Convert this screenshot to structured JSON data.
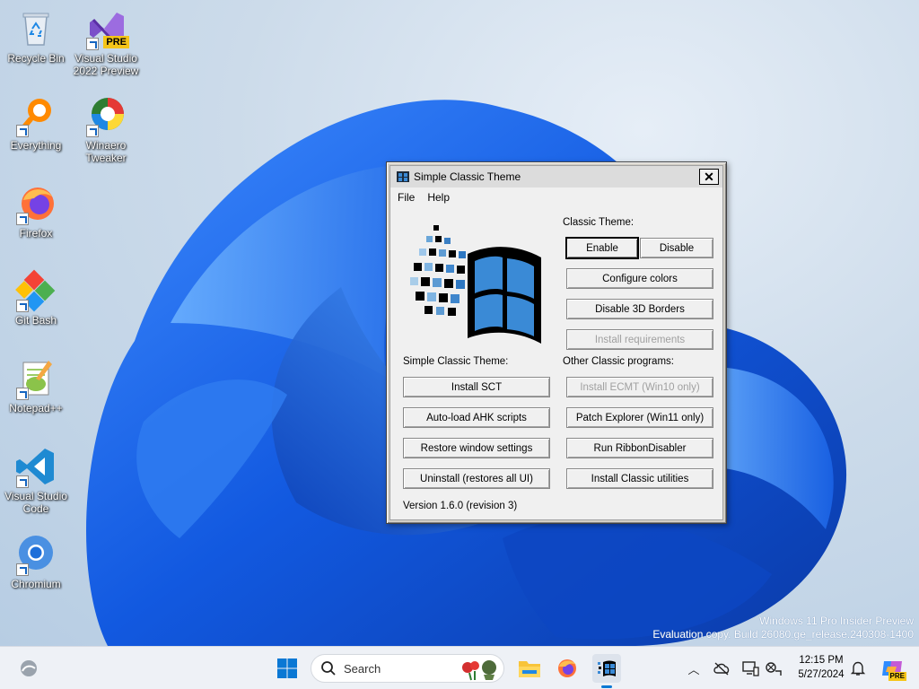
{
  "desktop": {
    "icons": [
      {
        "label": "Recycle Bin"
      },
      {
        "label": "Visual Studio 2022 Preview",
        "badge": "PRE"
      },
      {
        "label": "Everything"
      },
      {
        "label": "Winaero Tweaker"
      },
      {
        "label": "Firefox"
      },
      {
        "label": "Git Bash"
      },
      {
        "label": "Notepad++"
      },
      {
        "label": "Visual Studio Code"
      },
      {
        "label": "Chromium"
      }
    ],
    "watermark": {
      "line1": "Windows 11 Pro Insider Preview",
      "line2": "Evaluation copy. Build 26080.ge_release.240308-1400"
    }
  },
  "window": {
    "title": "Simple Classic Theme",
    "menu": [
      "File",
      "Help"
    ],
    "classic_theme_label": "Classic Theme:",
    "enable_label": "Enable",
    "disable_label": "Disable",
    "configure_colors_label": "Configure colors",
    "disable_3d_borders_label": "Disable 3D Borders",
    "install_requirements_label": "Install requirements",
    "sct_label": "Simple Classic Theme:",
    "other_label": "Other Classic programs:",
    "install_sct_label": "Install SCT",
    "install_ecmt_label": "Install ECMT (Win10 only)",
    "autoload_ahk_label": "Auto-load AHK scripts",
    "patch_explorer_label": "Patch Explorer (Win11 only)",
    "restore_window_label": "Restore window settings",
    "run_ribbon_label": "Run RibbonDisabler",
    "uninstall_label": "Uninstall (restores all UI)",
    "install_utilities_label": "Install Classic utilities",
    "version": "Version 1.6.0 (revision 3)"
  },
  "taskbar": {
    "search_placeholder": "Search",
    "time": "12:15 PM",
    "date": "5/27/2024",
    "copilot_badge": "PRE"
  },
  "colors": {
    "classic_face": "#f0f0f0",
    "wallpaper_blue": "#1a5fd6",
    "taskbar": "#eef1f6"
  }
}
